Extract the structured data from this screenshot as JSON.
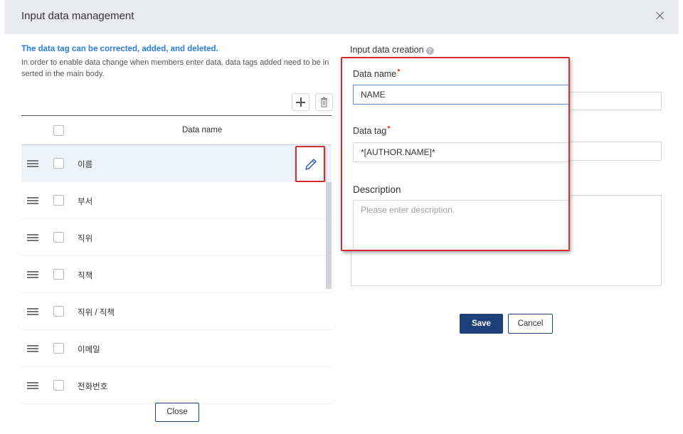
{
  "modal": {
    "title": "Input data management"
  },
  "info": {
    "title": "The data tag can be corrected, added, and deleted.",
    "text": "In order to enable data change when members enter data, data tags added need to be inserted in the main body."
  },
  "table": {
    "header": "Data name",
    "rows": [
      {
        "label": "이름"
      },
      {
        "label": "부서"
      },
      {
        "label": "직위"
      },
      {
        "label": "직책"
      },
      {
        "label": "직위 / 직책"
      },
      {
        "label": "이메일"
      },
      {
        "label": "전화번호"
      }
    ]
  },
  "footer": {
    "close_label": "Close"
  },
  "form": {
    "section_title": "Input data creation",
    "name_label": "Data name",
    "name_value": "NAME",
    "tag_label": "Data tag",
    "tag_value": "*[AUTHOR.NAME]*",
    "desc_label": "Description",
    "desc_placeholder": "Please enter description.",
    "save_label": "Save",
    "cancel_label": "Cancel"
  },
  "colors": {
    "primary": "#1f3f7a",
    "highlight": "#d52b2b",
    "info": "#2a7de1",
    "required": "#e8552e"
  }
}
